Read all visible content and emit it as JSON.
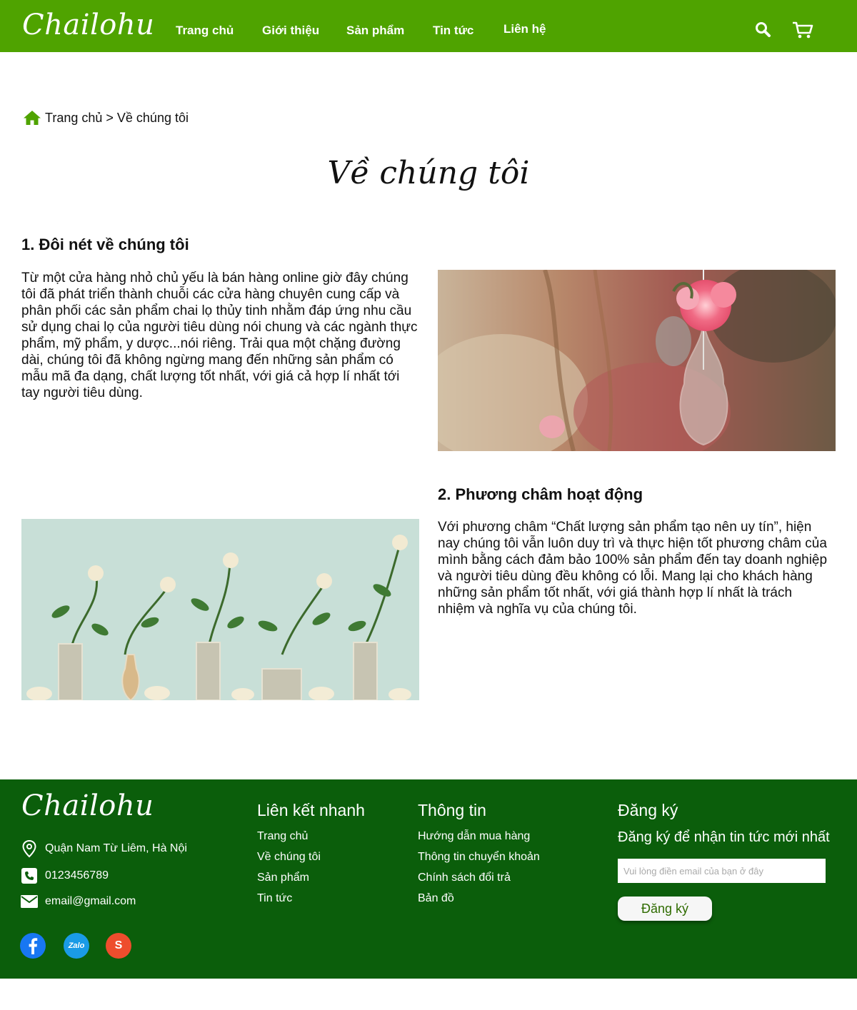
{
  "brand": {
    "logo": "Chailohu"
  },
  "nav": {
    "items": [
      "Trang chủ",
      "Giới thiệu",
      "Sản phẩm",
      "Tin tức",
      "Liên hệ"
    ],
    "icons": [
      "search-icon",
      "cart-icon"
    ]
  },
  "breadcrumb": {
    "home": "Trang chủ",
    "separator": ">",
    "current": "Về chúng tôi"
  },
  "page": {
    "title": "Về chúng tôi"
  },
  "section1": {
    "title": "1. Đôi nét về chúng tôi",
    "text": "Từ một cửa hàng nhỏ chủ yếu là bán hàng online giờ đây chúng tôi đã phát triển thành chuỗi các cửa hàng chuyên cung cấp và phân phối các sản phẩm chai lọ thủy tinh nhằm đáp ứng nhu cầu sử dụng chai lọ của người tiêu dùng nói chung và các ngành thực phẩm, mỹ phẩm, y dược...nói riêng. Trải qua một chặng đường dài, chúng tôi đã không ngừng mang đến những sản phẩm có mẫu mã đa dạng, chất lượng tốt nhất, với giá cả hợp lí nhất tới tay người tiêu dùng."
  },
  "section2": {
    "title": "2. Phương châm hoạt động",
    "text": "Với phương châm “Chất lượng sản phẩm tạo nên uy tín”, hiện nay chúng tôi vẫn luôn duy trì và thực hiện tốt phương châm của\nmình bằng cách đảm bảo 100% sản phẩm đến tay doanh nghiệp và người tiêu dùng đều không có lỗi. Mang lại cho khách hàng\nnhững sản phẩm tốt nhất, với giá thành hợp lí nhất là trách nhiệm và nghĩa vụ của chúng tôi."
  },
  "footer": {
    "logo": "Chailohu",
    "address": "Quận Nam Từ Liêm, Hà Nội",
    "phone": "0123456789",
    "email": "email@gmail.com",
    "quick_links": {
      "title": "Liên kết nhanh",
      "items": [
        "Trang chủ",
        "Về chúng tôi",
        "Sản phẩm",
        "Tin tức"
      ]
    },
    "info": {
      "title": "Thông tin",
      "items": [
        "Hướng dẫn mua hàng",
        "Thông tin chuyển khoản",
        "Chính sách đổi trả",
        "Bản đồ"
      ]
    },
    "subscribe": {
      "title": "Đăng ký",
      "subtitle": "Đăng ký để nhận tin tức mới nhất",
      "placeholder": "Vui lòng điền email của bạn ở đây",
      "button": "Đăng ký"
    },
    "social": [
      {
        "icon": "facebook-icon",
        "color": "#1877f2"
      },
      {
        "icon": "zalo-icon",
        "color": "#1a9be6",
        "label": "Zalo"
      },
      {
        "icon": "shopee-icon",
        "color": "#ee4d2d",
        "label": "S"
      }
    ]
  },
  "colors": {
    "header": "#4fa300",
    "footer": "#0b5e0b",
    "home_icon": "#4fa300"
  }
}
